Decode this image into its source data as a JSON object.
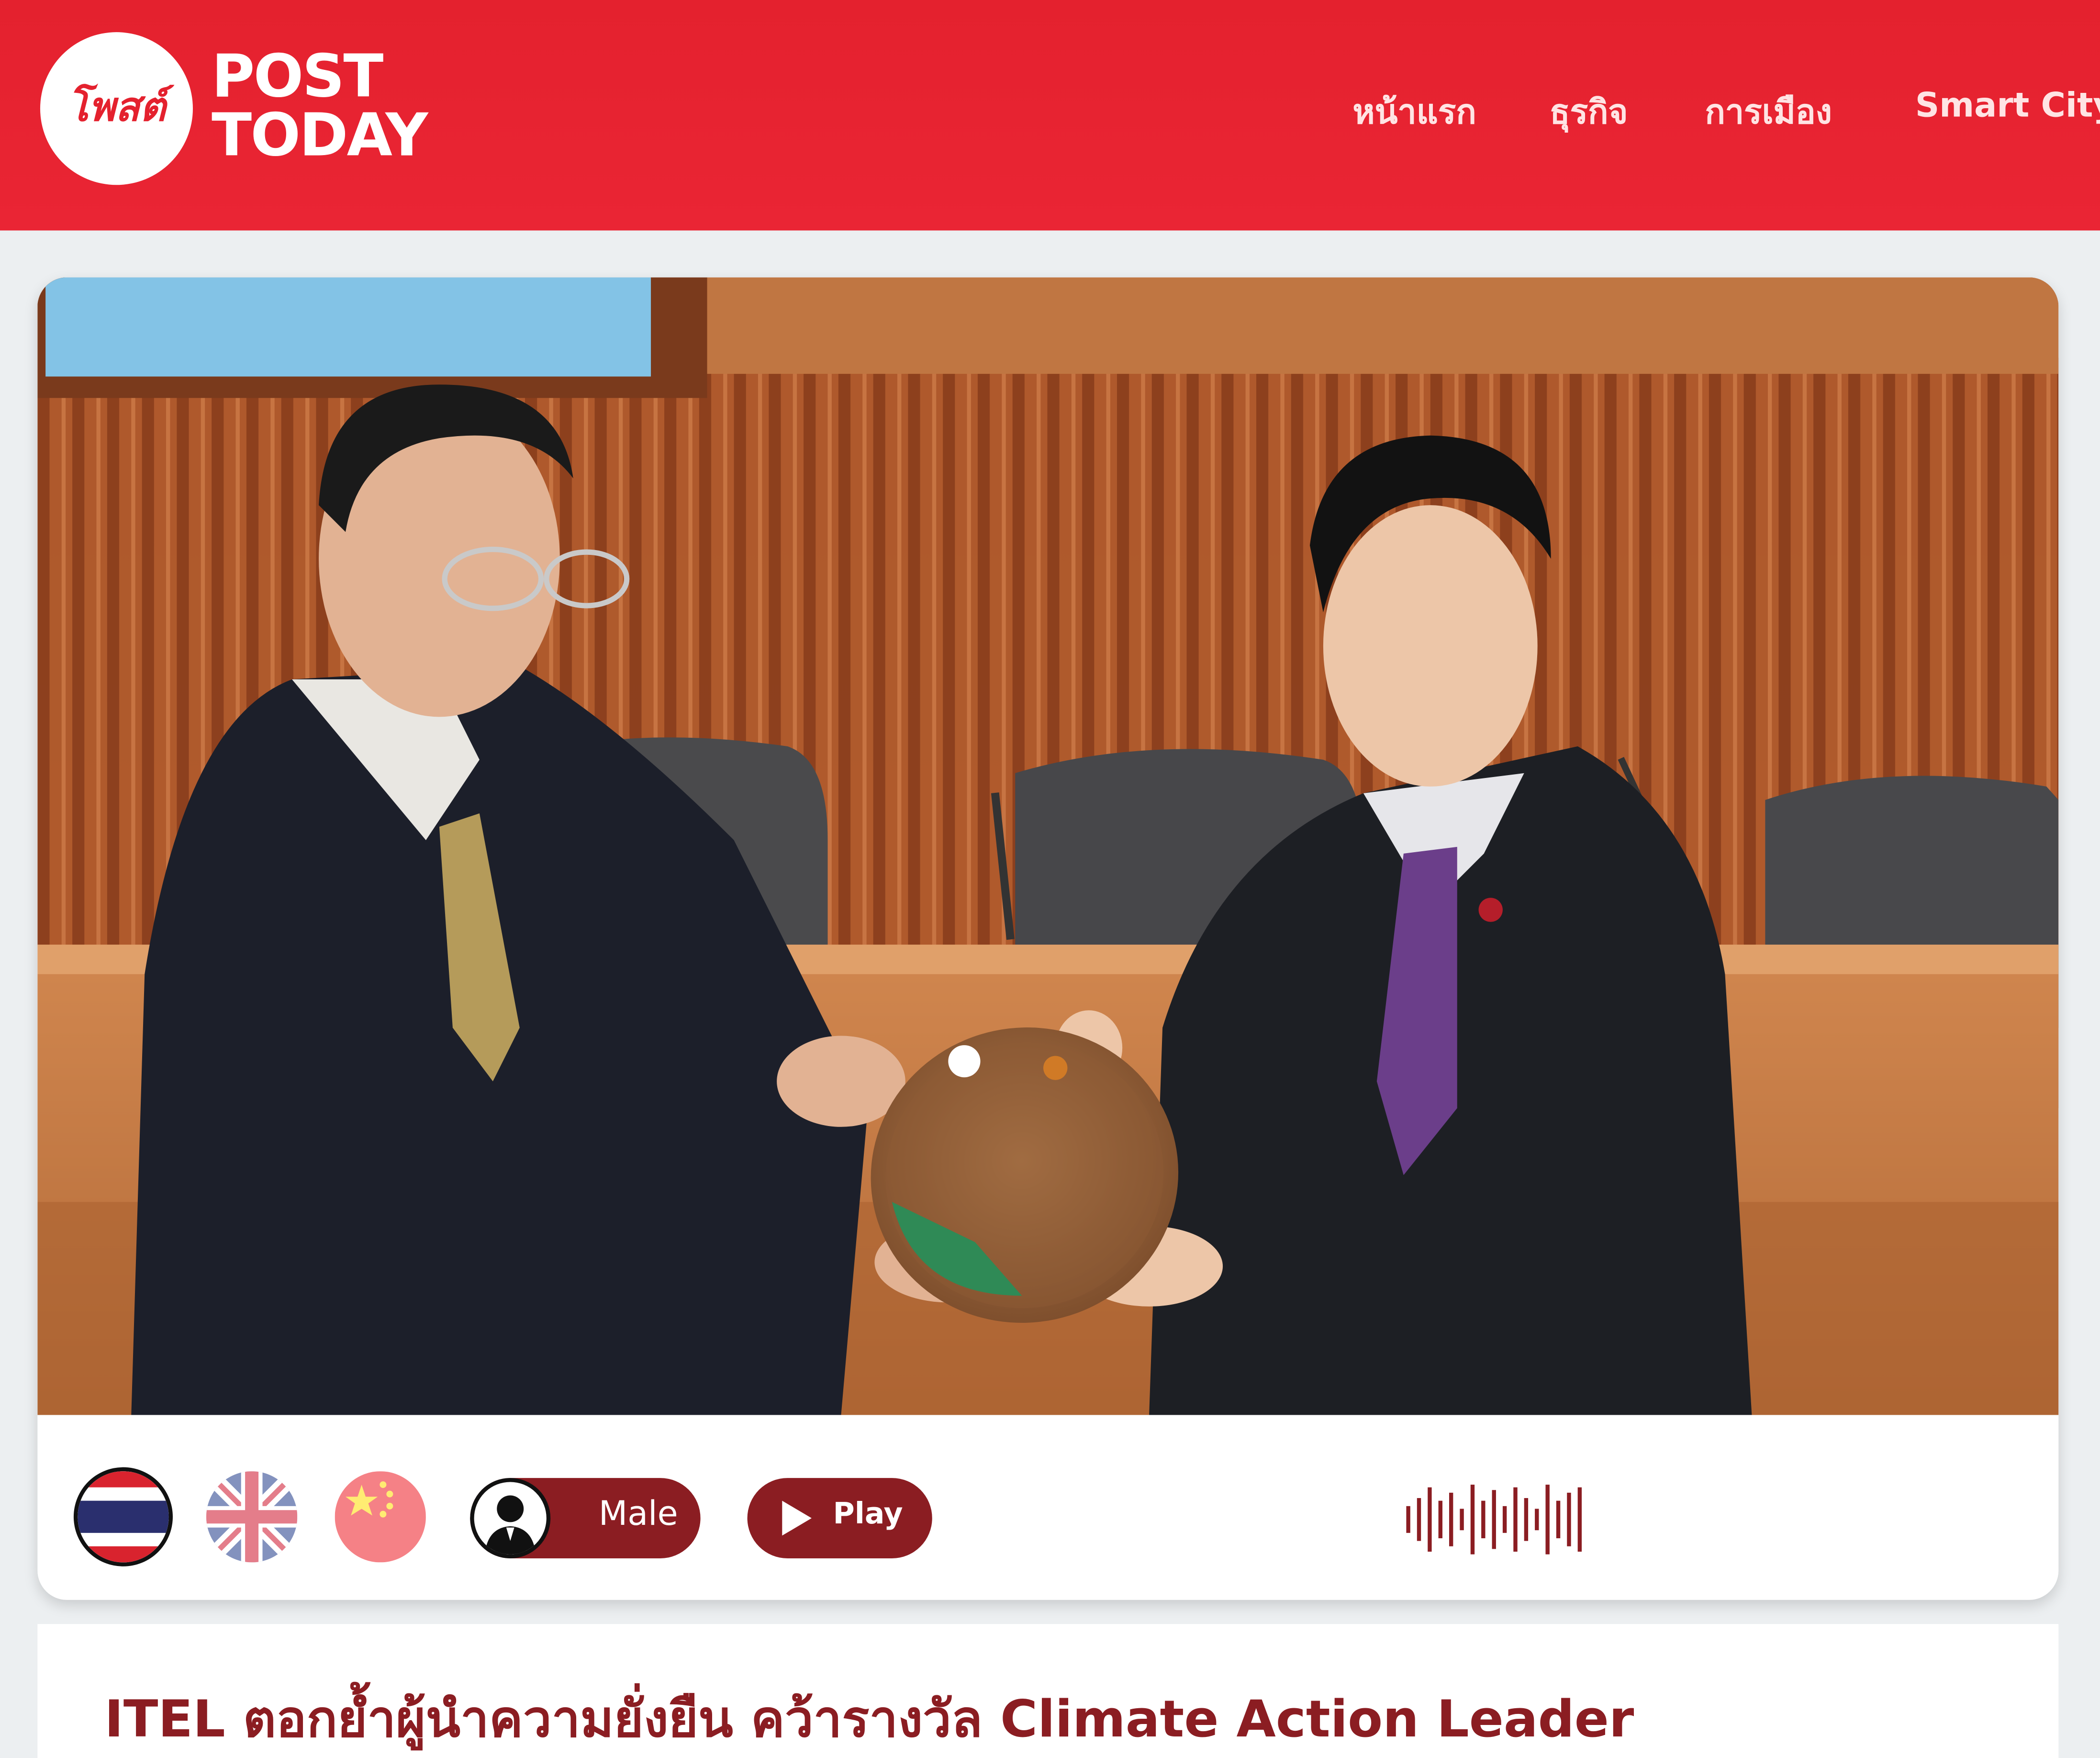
{
  "site": {
    "logo_line1": "POST",
    "logo_line2": "TODAY",
    "logo_script": "โพสต์",
    "brand_color": "#e4212e",
    "accent_color": "#8b1d22"
  },
  "nav": {
    "items": [
      {
        "label": "หน้าแรก"
      },
      {
        "label": "ธุรกิจ"
      },
      {
        "label": "การเมือง"
      },
      {
        "label": "Smart City"
      }
    ]
  },
  "article": {
    "image_alt": "Award presentation photo",
    "title": "ITEL ตอกย้ำผู้นำความยั่งยืน คว้ารางวัล Climate Action Leader"
  },
  "audio": {
    "languages": [
      {
        "name": "thai-flag-icon"
      },
      {
        "name": "uk-flag-icon"
      },
      {
        "name": "china-flag-icon"
      }
    ],
    "voice_label": "Male",
    "play_label": "Play"
  }
}
